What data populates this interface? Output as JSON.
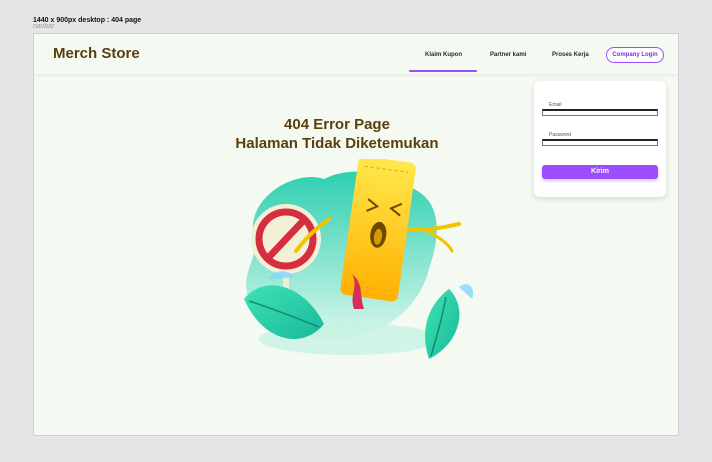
{
  "canvas": {
    "label": "1440 x 900px desktop : 404 page",
    "ghost_label": "navbar"
  },
  "navbar": {
    "brand": "Merch Store",
    "links": [
      {
        "label": "Klaim Kupon",
        "active": true
      },
      {
        "label": "Partner kami",
        "active": false
      },
      {
        "label": "Proses Kerja",
        "active": false
      }
    ],
    "login_button": "Company Login"
  },
  "login_form": {
    "email_label": "Email",
    "password_label": "Password",
    "submit_label": "Kirim"
  },
  "error": {
    "title": "404 Error Page",
    "subtitle": "Halaman Tidak Diketemukan"
  },
  "colors": {
    "accent": "#9b4dff",
    "brand": "#5b3f0c",
    "background": "#f4f9f2"
  },
  "icons": [
    "no-entry-sign-icon",
    "ticket-character-icon",
    "leaf-icon"
  ]
}
